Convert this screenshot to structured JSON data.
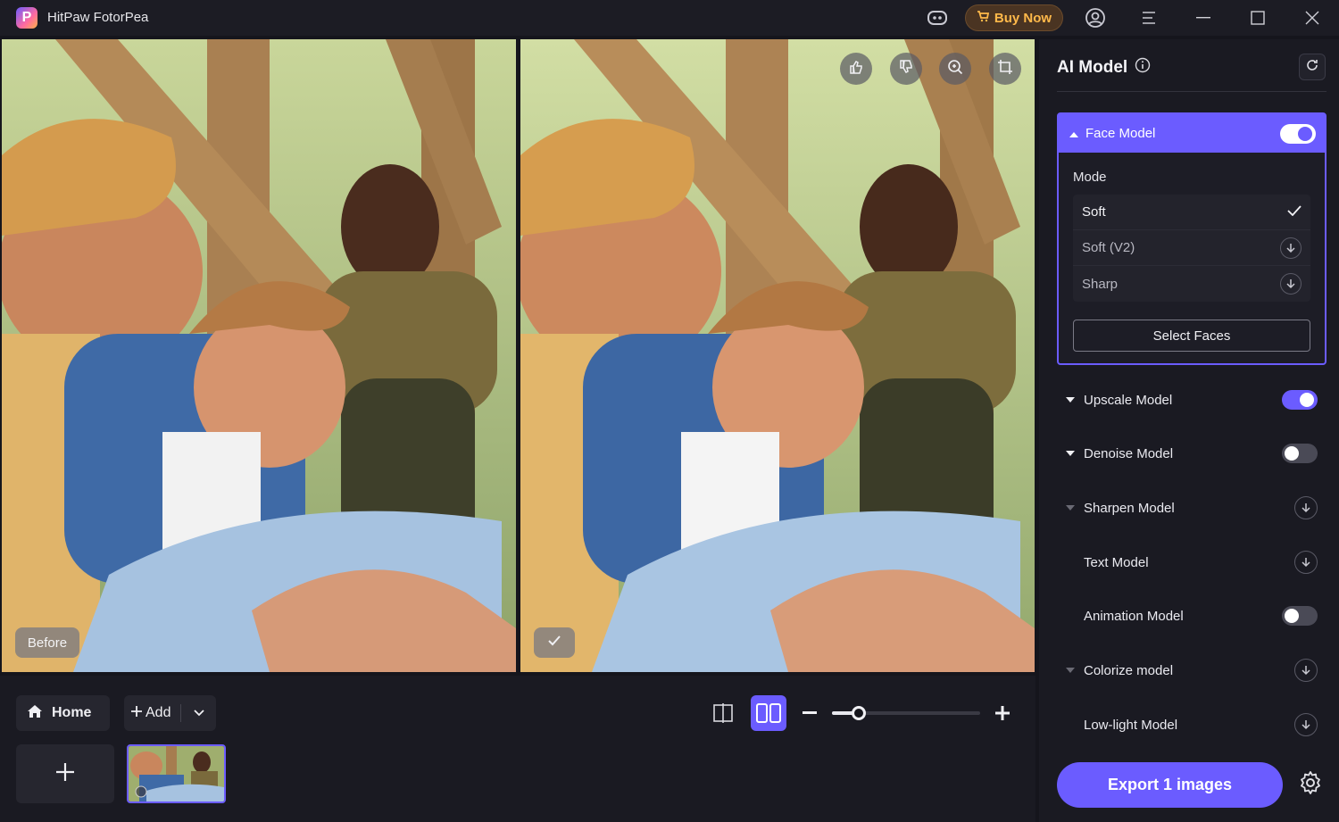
{
  "app": {
    "title": "HitPaw FotorPea",
    "logo_letter": "P"
  },
  "titlebar": {
    "buy_label": "Buy Now"
  },
  "preview": {
    "before_label": "Before"
  },
  "bottom": {
    "home_label": "Home",
    "add_label": "Add",
    "zoom_level": 0.18
  },
  "panel": {
    "title": "AI Model",
    "face_model": {
      "label": "Face Model",
      "enabled": true,
      "mode_label": "Mode",
      "modes": [
        {
          "label": "Soft",
          "state": "selected"
        },
        {
          "label": "Soft (V2)",
          "state": "download"
        },
        {
          "label": "Sharp",
          "state": "download"
        }
      ],
      "select_faces_label": "Select Faces"
    },
    "models": [
      {
        "label": "Upscale Model",
        "control": "toggle-on",
        "caret": true
      },
      {
        "label": "Denoise Model",
        "control": "toggle-off",
        "caret": true
      },
      {
        "label": "Sharpen Model",
        "control": "download",
        "caret": true
      },
      {
        "label": "Text Model",
        "control": "download",
        "caret": false
      },
      {
        "label": "Animation Model",
        "control": "toggle-off",
        "caret": false
      },
      {
        "label": "Colorize model",
        "control": "download",
        "caret": true
      },
      {
        "label": "Low-light Model",
        "control": "download",
        "caret": false
      }
    ],
    "export_label": "Export 1 images"
  },
  "colors": {
    "accent": "#6b5cff",
    "buy_text": "#ffb94a",
    "panel_bg": "#1a1a22"
  }
}
